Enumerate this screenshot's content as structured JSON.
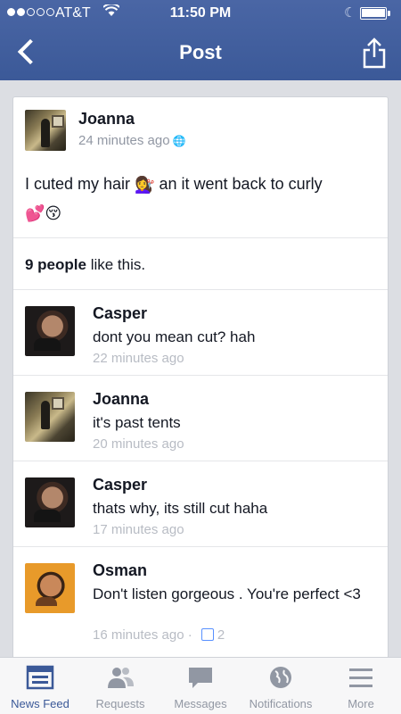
{
  "status_bar": {
    "carrier": "AT&T",
    "time": "11:50 PM",
    "signal_bars": 2,
    "battery_level_percent": 90
  },
  "navbar": {
    "title": "Post",
    "back_icon": "chevron-left-icon",
    "share_icon": "share-icon"
  },
  "post": {
    "author": "Joanna",
    "time": "24 minutes ago",
    "privacy_icon": "globe-icon",
    "text_before": "I cuted my hair",
    "emoji_1": "💇‍♀️",
    "text_after": "an it went back to curly",
    "emoji_2": "💕😚",
    "likes_count": "9 people",
    "likes_suffix": "like this."
  },
  "comments": [
    {
      "name": "Casper",
      "text": "dont you mean cut? hah",
      "time": "22 minutes ago",
      "avatar": "casper"
    },
    {
      "name": "Joanna",
      "text": "it's past tents",
      "time": "20 minutes ago",
      "avatar": "joanna"
    },
    {
      "name": "Casper",
      "text": "thats why, its still cut haha",
      "time": "17 minutes ago",
      "avatar": "casper"
    },
    {
      "name": "Osman",
      "text": "Don't listen gorgeous . You're perfect <3",
      "time": "16 minutes ago",
      "separator": "·",
      "like_count": "2",
      "avatar": "osman"
    }
  ],
  "tab_bar": {
    "tabs": [
      {
        "label": "News Feed",
        "icon": "news-feed-icon",
        "active": true
      },
      {
        "label": "Requests",
        "icon": "friend-requests-icon",
        "active": false
      },
      {
        "label": "Messages",
        "icon": "messages-icon",
        "active": false
      },
      {
        "label": "Notifications",
        "icon": "globe-icon",
        "active": false
      },
      {
        "label": "More",
        "icon": "menu-icon",
        "active": false
      }
    ]
  },
  "colors": {
    "header_blue": "#3b5998",
    "link_blue": "#5890ff",
    "muted_text": "#9197a3"
  }
}
